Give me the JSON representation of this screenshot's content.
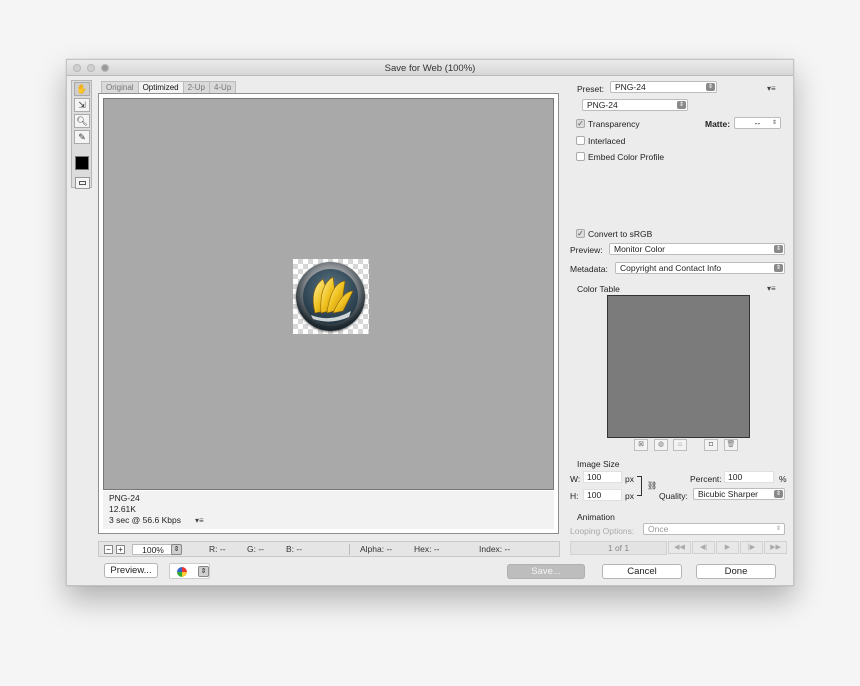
{
  "window": {
    "title": "Save for Web (100%)"
  },
  "tabs": [
    "Original",
    "Optimized",
    "2-Up",
    "4-Up"
  ],
  "image_info": {
    "format": "PNG-24",
    "size": "12.61K",
    "time": "3 sec @ 56.6 Kbps"
  },
  "status": {
    "zoom": "100%",
    "r": "R: --",
    "g": "G: --",
    "b": "B: --",
    "alpha": "Alpha: --",
    "hex": "Hex: --",
    "index": "Index: --"
  },
  "buttons": {
    "preview": "Preview...",
    "save": "Save...",
    "cancel": "Cancel",
    "done": "Done"
  },
  "settings": {
    "preset_label": "Preset:",
    "preset_value": "PNG-24",
    "format_value": "PNG-24",
    "transparency": "Transparency",
    "matte_label": "Matte:",
    "matte_value": "--",
    "interlaced": "Interlaced",
    "embed_profile": "Embed Color Profile",
    "convert_srgb": "Convert to sRGB",
    "preview_label": "Preview:",
    "preview_value": "Monitor Color",
    "metadata_label": "Metadata:",
    "metadata_value": "Copyright and Contact Info",
    "color_table": "Color Table"
  },
  "image_size": {
    "title": "Image Size",
    "w_label": "W:",
    "w_value": "100",
    "h_label": "H:",
    "h_value": "100",
    "px": "px",
    "percent_label": "Percent:",
    "percent_value": "100",
    "percent_unit": "%",
    "quality_label": "Quality:",
    "quality_value": "Bicubic Sharper"
  },
  "animation": {
    "title": "Animation",
    "looping_label": "Looping Options:",
    "looping_value": "Once",
    "frame": "1 of 1"
  },
  "colors": {
    "highlight": "#e23ad0",
    "color_table_bg": "#7b7b7b",
    "canvas_bg": "#a9a9a9",
    "foreground": "#000000"
  },
  "icons": [
    "hand-icon",
    "slice-select-icon",
    "zoom-icon",
    "eyedropper-icon",
    "foreground-color-swatch",
    "toggle-slices-icon",
    "browser-icon",
    "menu-icon",
    "link-icon"
  ]
}
